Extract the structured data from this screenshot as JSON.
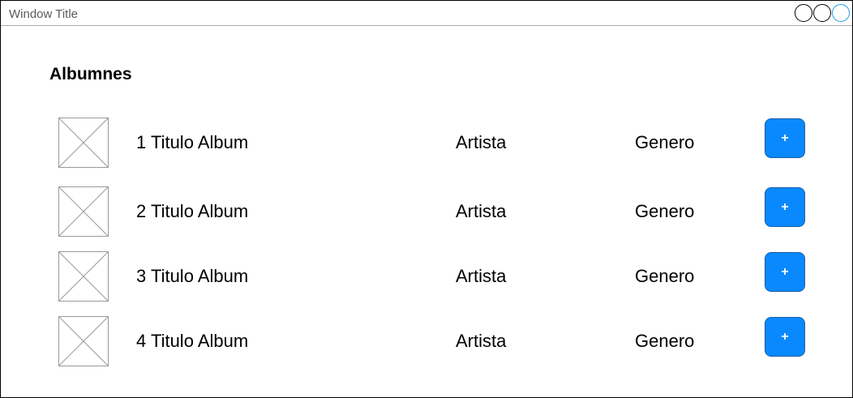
{
  "window": {
    "title": "Window Title"
  },
  "page": {
    "heading": "Albumnes"
  },
  "albums": [
    {
      "title": "1 Titulo Album",
      "artist": "Artista",
      "genre": "Genero",
      "add_label": "+"
    },
    {
      "title": "2 Titulo Album",
      "artist": "Artista",
      "genre": "Genero",
      "add_label": "+"
    },
    {
      "title": "3 Titulo Album",
      "artist": "Artista",
      "genre": "Genero",
      "add_label": "+"
    },
    {
      "title": "4 Titulo Album",
      "artist": "Artista",
      "genre": "Genero",
      "add_label": "+"
    }
  ],
  "colors": {
    "accent": "#0a89ff",
    "close_control": "#1a9be8"
  },
  "icons": {
    "thumbnail": "image-placeholder-icon",
    "add": "plus-icon"
  }
}
